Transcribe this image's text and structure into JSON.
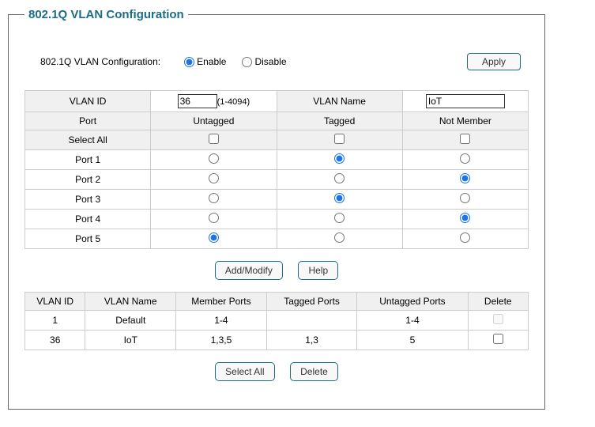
{
  "legend": "802.1Q VLAN Configuration",
  "config": {
    "label": "802.1Q VLAN Configuration:",
    "enable": "Enable",
    "disable": "Disable",
    "apply": "Apply"
  },
  "editTable": {
    "vlanIdHeader": "VLAN ID",
    "vlanIdValue": "36",
    "rangeText": "(1-4094)",
    "vlanNameHeader": "VLAN Name",
    "vlanNameValue": "IoT",
    "portHeader": "Port",
    "untaggedHeader": "Untagged",
    "taggedHeader": "Tagged",
    "notMemberHeader": "Not Member",
    "selectAll": "Select All",
    "ports": [
      "Port 1",
      "Port 2",
      "Port 3",
      "Port 4",
      "Port 5"
    ]
  },
  "buttons": {
    "addModify": "Add/Modify",
    "help": "Help",
    "selectAll": "Select All",
    "delete": "Delete"
  },
  "listTable": {
    "headers": {
      "vlanId": "VLAN ID",
      "vlanName": "VLAN Name",
      "memberPorts": "Member Ports",
      "taggedPorts": "Tagged Ports",
      "untaggedPorts": "Untagged Ports",
      "delete": "Delete"
    },
    "rows": [
      {
        "id": "1",
        "name": "Default",
        "member": "1-4",
        "tagged": "",
        "untagged": "1-4"
      },
      {
        "id": "36",
        "name": "IoT",
        "member": "1,3,5",
        "tagged": "1,3",
        "untagged": "5"
      }
    ]
  }
}
